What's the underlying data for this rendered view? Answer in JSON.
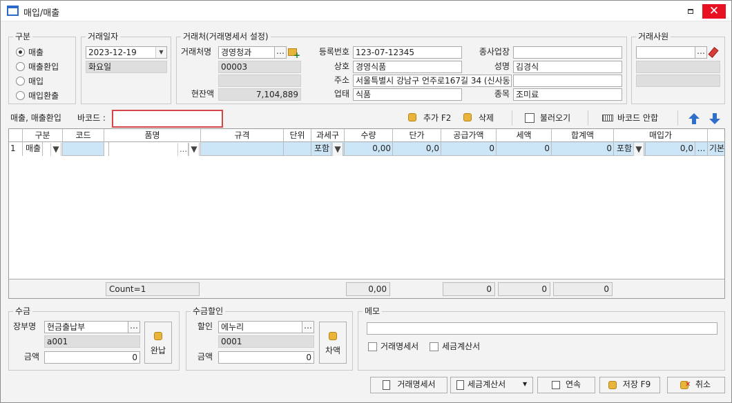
{
  "window": {
    "title": "매입/매출"
  },
  "type_group": {
    "label": "구분",
    "options": [
      "매출",
      "매출환입",
      "매입",
      "매입환출"
    ],
    "selected": 0
  },
  "date_group": {
    "label": "거래일자",
    "date": "2023-12-19",
    "weekday": "화요일"
  },
  "partner_group": {
    "label": "거래처(거래명세서 설정)",
    "name_label": "거래처명",
    "name": "경영청과",
    "code": "00003",
    "balance_label": "현잔액",
    "balance": "7,104,889",
    "reg_label": "등록번호",
    "reg_no": "123-07-12345",
    "company_label": "상호",
    "company": "경영식품",
    "address_label": "주소",
    "address": "서울특별시 강남구 언주로167길 34 (신사동",
    "business_label": "업태",
    "business": "식품",
    "branch_label": "종사업장",
    "branch": "",
    "owner_label": "성명",
    "owner": "김경식",
    "item_label": "종목",
    "item": "조미료"
  },
  "staff_group": {
    "label": "거래사원",
    "value": ""
  },
  "toolbar": {
    "mode_label": "매출, 매출환입",
    "barcode_label": "바코드 :",
    "barcode_value": "",
    "add_label": "추가 F2",
    "delete_label": "삭제",
    "load_label": "불러오기",
    "barcode_guide_label": "바코드 안합"
  },
  "grid": {
    "headers": [
      "",
      "구분",
      "코드",
      "품명",
      "규격",
      "단위",
      "과세구",
      "수량",
      "단가",
      "공급가액",
      "세액",
      "합계액",
      "매입가",
      ""
    ],
    "row": {
      "no": "1",
      "type": "매출",
      "code": "",
      "name": "",
      "spec": "",
      "unit": "",
      "tax": "포함",
      "qty": "0,00",
      "price": "0,0",
      "supply": "0",
      "vat": "0",
      "total": "0",
      "ptax": "포함",
      "pprice": "0,0",
      "last": "기본"
    },
    "footer": {
      "count": "Count=1",
      "qty": "0,00",
      "supply": "0",
      "vat": "0",
      "total": "0"
    }
  },
  "receipt_group": {
    "label": "수금",
    "ledger_label": "장부명",
    "ledger": "현금출납부",
    "code": "a001",
    "amount_label": "금액",
    "amount": "0",
    "complete_label": "완납"
  },
  "discount_group": {
    "label": "수금할인",
    "discount_label": "할인",
    "discount": "에누리",
    "code": "0001",
    "amount_label": "금액",
    "amount": "0",
    "diff_label": "차액"
  },
  "memo_group": {
    "label": "메모",
    "memo": "",
    "chk_statement": "거래명세서",
    "chk_invoice": "세금계산서"
  },
  "bottom": {
    "statement": "거래명세서",
    "invoice": "세금계산서",
    "continue": "연속",
    "save": "저장 F9",
    "cancel": "취소"
  }
}
